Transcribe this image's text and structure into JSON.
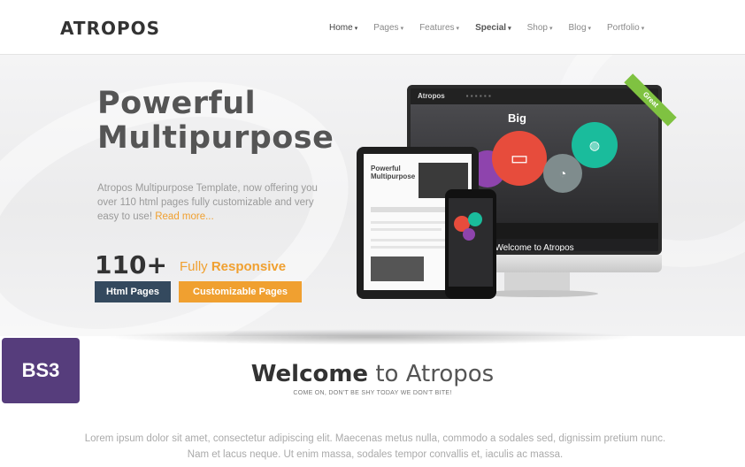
{
  "header": {
    "logo": "ATROPOS",
    "nav": [
      {
        "label": "Home",
        "name": "nav-home"
      },
      {
        "label": "Pages",
        "name": "nav-pages"
      },
      {
        "label": "Features",
        "name": "nav-features"
      },
      {
        "label": "Special",
        "name": "nav-special"
      },
      {
        "label": "Shop",
        "name": "nav-shop"
      },
      {
        "label": "Blog",
        "name": "nav-blog"
      },
      {
        "label": "Portfolio",
        "name": "nav-portfolio"
      }
    ]
  },
  "hero": {
    "title_line1": "Powerful",
    "title_line2": "Multipurpose",
    "description": "Atropos Multipurpose Template, now offering you over 110 html pages fully customizable and very easy to use!",
    "read_more": "Read more...",
    "count": "110+",
    "responsive_prefix": "Fully",
    "responsive_word": "Responsive",
    "badge_html": "Html Pages",
    "badge_custom": "Customizable Pages",
    "mockup": {
      "monitor_brand": "Atropos",
      "monitor_big": "Big",
      "monitor_welcome": "Welcome to Atropos",
      "ribbon": "Great"
    }
  },
  "badge": {
    "label": "BS3"
  },
  "welcome": {
    "title_bold": "Welcome",
    "title_rest": " to Atropos",
    "subtitle": "COME ON, DON'T BE SHY TODAY WE DON'T BITE!",
    "lorem": "Lorem ipsum dolor sit amet, consectetur adipiscing elit. Maecenas metus nulla, commodo a sodales sed, dignissim pretium nunc. Nam et lacus neque. Ut enim massa, sodales tempor convallis et, iaculis ac massa."
  },
  "colors": {
    "accent": "#f0a030",
    "dark_badge": "#34495e",
    "bootstrap_purple": "#563d7c"
  }
}
